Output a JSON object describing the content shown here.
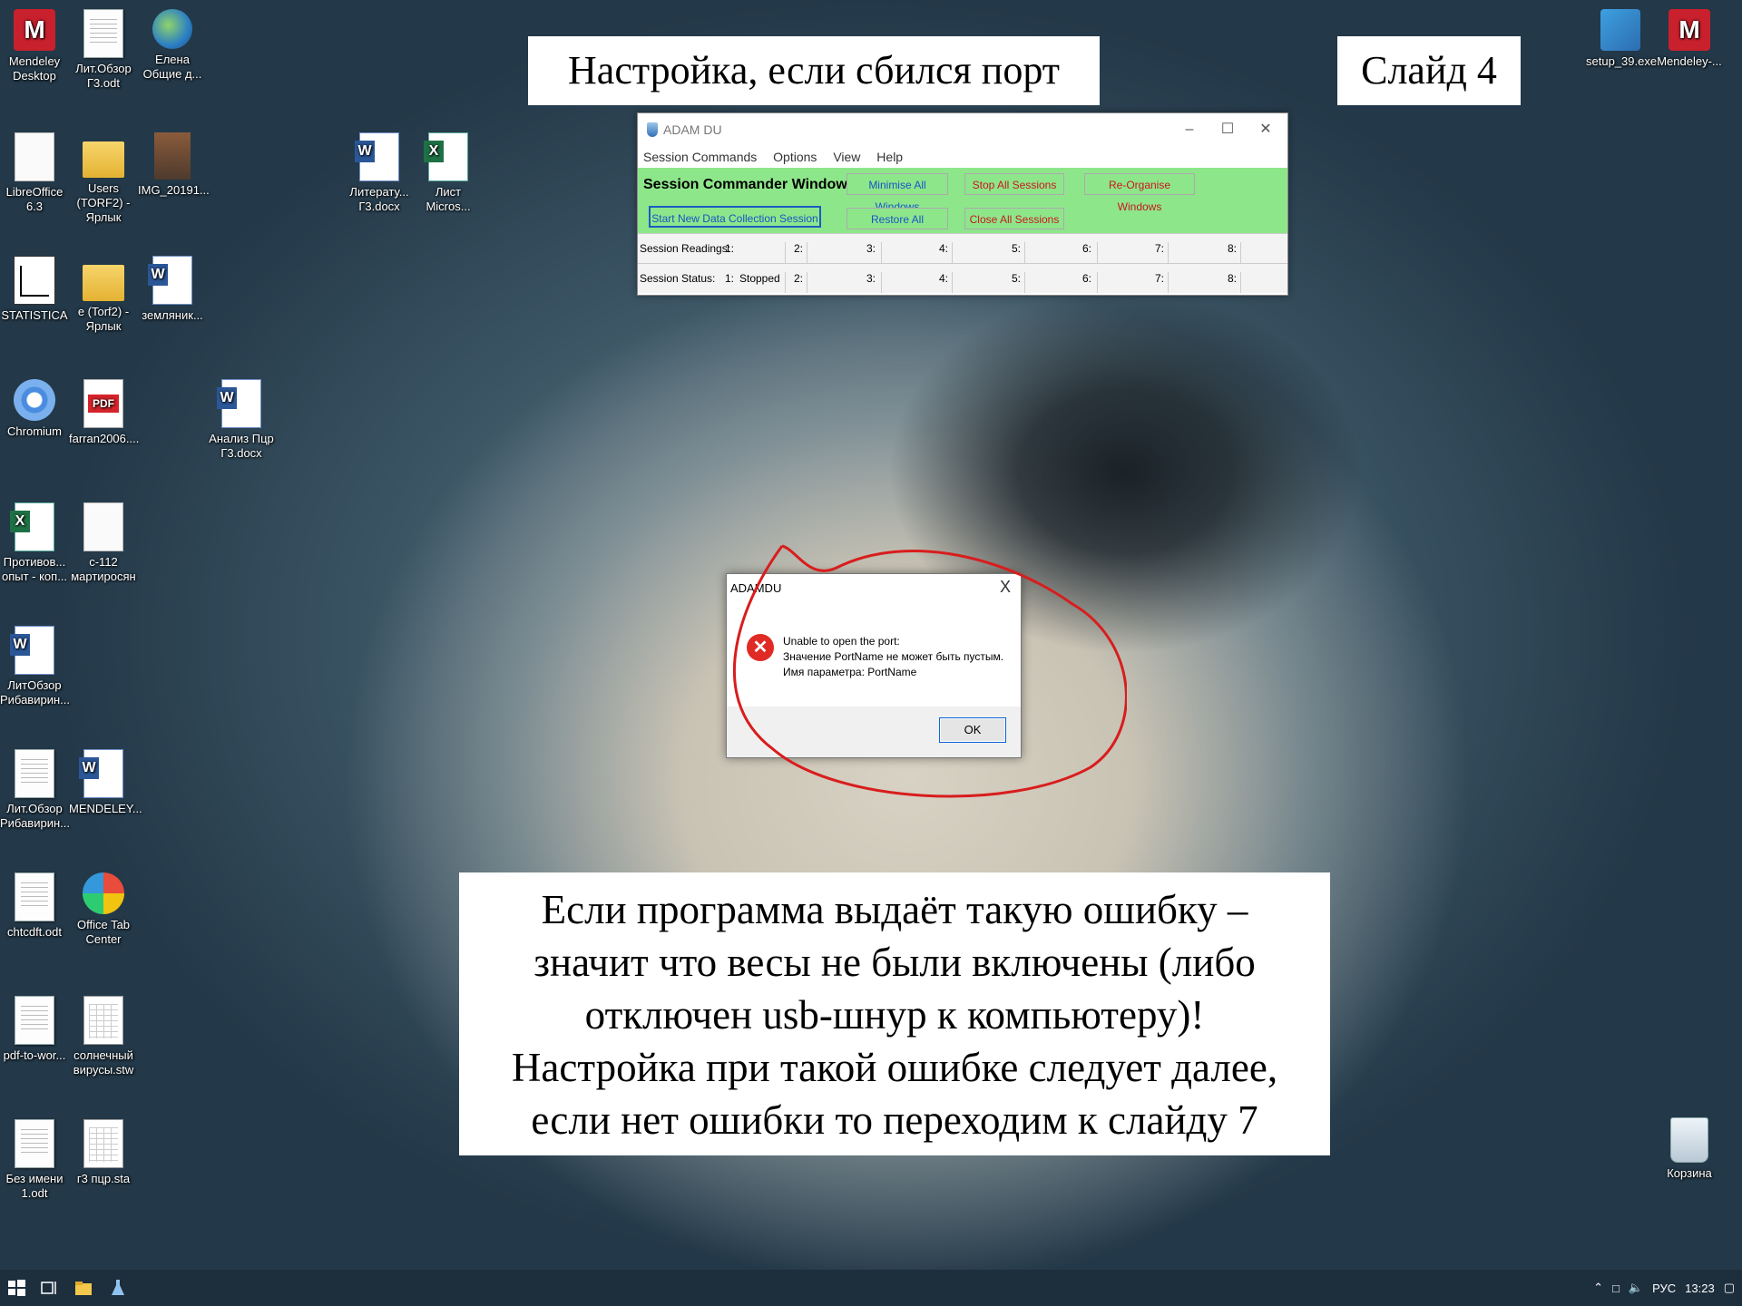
{
  "slide": {
    "title": "Настройка, если сбился порт",
    "slide_number": "Слайд 4",
    "info_lines": [
      "Если программа выдаёт такую ошибку –",
      "значит что весы не были включены (либо",
      "отключен usb-шнур к компьютеру)!",
      "Настройка при такой ошибке следует далее,",
      "если нет ошибки то переходим к слайду 7"
    ]
  },
  "desktop_icons": {
    "mendeley_desktop": "Mendeley Desktop",
    "lit_obzor_g3": "Лит.Обзор Г3.odt",
    "elena": "Елена Общие д...",
    "libreoffice": "LibreOffice 6.3",
    "users_torf2": "Users (TORF2) - Ярлык",
    "img_2019": "IMG_20191...",
    "literatura": "Литерату... Г3.docx",
    "list_micros": "Лист Micros...",
    "statistica": "STATISTICA",
    "e_torf2": "e (Torf2) - Ярлык",
    "zemlyanik": "земляник...",
    "chromium": "Chromium",
    "farran": "farran2006....",
    "analiz": "Анализ Пцр Г3.docx",
    "protivov": "Противов... опыт - коп...",
    "c112": "с-112 мартиросян",
    "litobzor_riba1": "ЛитОбзор Рибавирин...",
    "litobzor_riba2": "Лит.Обзор Рибавирин...",
    "mendeley_doc": "MENDELEY...",
    "chtcdft": "chtcdft.odt",
    "office_tab": "Office Tab Center",
    "pdf_to_wor": "pdf-to-wor...",
    "solnechny": "солнечный вирусы.stw",
    "bez_imeni": "Без имени 1.odt",
    "g3_pcr": "г3 пцр.sta",
    "setup": "setup_39.exe",
    "mendeley_right": "Mendeley-...",
    "korzina": "Корзина"
  },
  "adam_window": {
    "title": "ADAM DU",
    "menu": [
      "Session Commands",
      "Options",
      "View",
      "Help"
    ],
    "heading": "Session Commander Window",
    "buttons": {
      "minimise_all": "Minimise All Windows",
      "stop_all": "Stop All Sessions",
      "reorganise": "Re-Organise Windows",
      "start_new": "Start New Data Collection Session",
      "restore_all": "Restore All Windows",
      "close_all": "Close All Sessions"
    },
    "readings_label": "Session Readings:",
    "status_label": "Session Status:",
    "slots": [
      "1:",
      "2:",
      "3:",
      "4:",
      "5:",
      "6:",
      "7:",
      "8:"
    ],
    "status_values": [
      "Stopped",
      "",
      "",
      "",
      "",
      "",
      "",
      ""
    ]
  },
  "error_dialog": {
    "title": "ADAMDU",
    "close": "X",
    "message_line1": "Unable to open the port:",
    "message_line2": "Значение PortName не может быть пустым.",
    "message_line3": "Имя параметра: PortName",
    "ok_label": "OK"
  },
  "taskbar": {
    "language": "РУС",
    "time": "13:23"
  },
  "colors": {
    "adam_green": "#8ee68a",
    "annotation_red": "#d81d1d",
    "taskbar_bg": "#1d2e3d"
  }
}
